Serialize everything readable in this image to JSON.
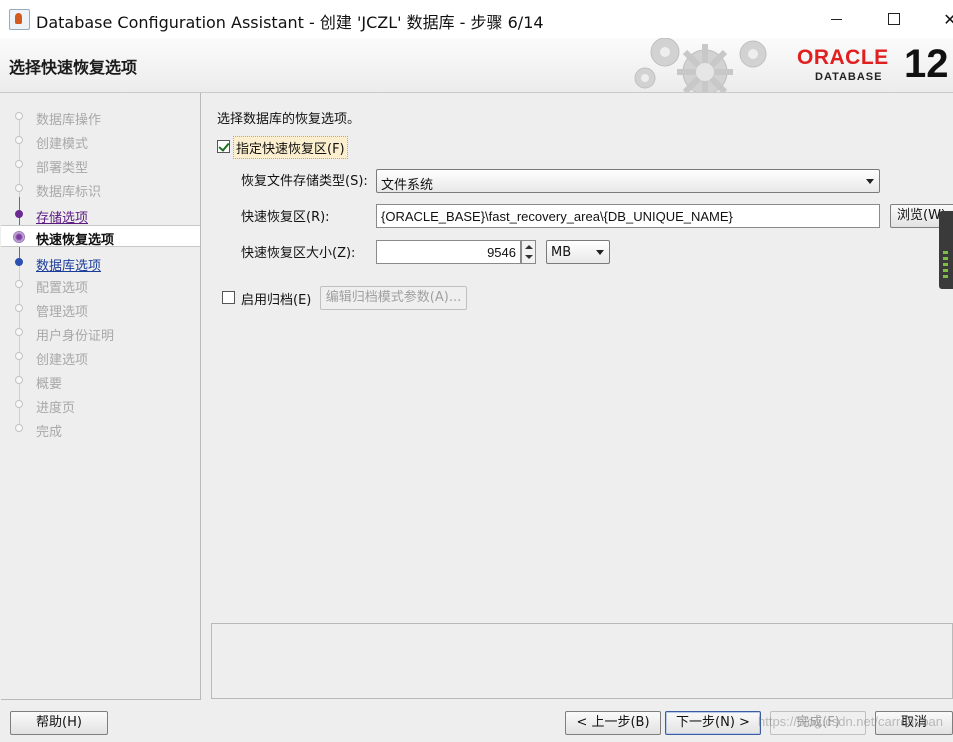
{
  "window": {
    "title": "Database Configuration Assistant - 创建 'JCZL' 数据库 - 步骤 6/14",
    "minimize_label": "—",
    "close_label": "✕"
  },
  "header": {
    "title": "选择快速恢复选项",
    "brand": "ORACLE",
    "brand_sub": "DATABASE",
    "version": "12"
  },
  "steps": [
    {
      "label": "数据库操作",
      "state": "disabled"
    },
    {
      "label": "创建模式",
      "state": "disabled"
    },
    {
      "label": "部署类型",
      "state": "disabled"
    },
    {
      "label": "数据库标识",
      "state": "disabled"
    },
    {
      "label": "存储选项",
      "state": "visited"
    },
    {
      "label": "快速恢复选项",
      "state": "current"
    },
    {
      "label": "数据库选项",
      "state": "link"
    },
    {
      "label": "配置选项",
      "state": "disabled"
    },
    {
      "label": "管理选项",
      "state": "disabled"
    },
    {
      "label": "用户身份证明",
      "state": "disabled"
    },
    {
      "label": "创建选项",
      "state": "disabled"
    },
    {
      "label": "概要",
      "state": "disabled"
    },
    {
      "label": "进度页",
      "state": "disabled"
    },
    {
      "label": "完成",
      "state": "disabled"
    }
  ],
  "form": {
    "intro": "选择数据库的恢复选项。",
    "fra_checkbox_label": "指定快速恢复区(F)",
    "fra_checked": true,
    "storage_type_label": "恢复文件存储类型(S):",
    "storage_type_value": "文件系统",
    "fra_location_label": "快速恢复区(R):",
    "fra_location_value": "{ORACLE_BASE}\\fast_recovery_area\\{DB_UNIQUE_NAME}",
    "browse_label": "浏览(W)...",
    "fra_size_label": "快速恢复区大小(Z):",
    "fra_size_value": "9546",
    "fra_size_unit": "MB",
    "archive_checkbox_label": "启用归档(E)",
    "archive_checked": false,
    "archive_params_label": "编辑归档模式参数(A)..."
  },
  "footer": {
    "help_label": "帮助(H)",
    "back_label": "< 上一步(B)",
    "next_label": "下一步(N) >",
    "finish_label": "完成(F)",
    "cancel_label": "取消"
  },
  "watermark": "https://blog.csdn.net/carrotluoan"
}
